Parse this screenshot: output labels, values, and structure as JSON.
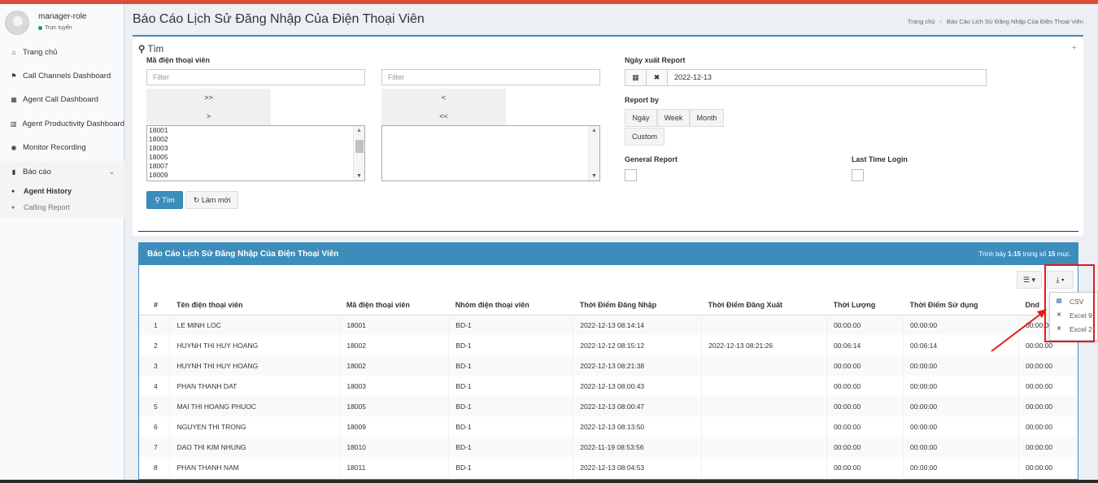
{
  "sidebar": {
    "user_name": "manager-role",
    "user_status": "Trực tuyến",
    "items": [
      {
        "label": "Trang chủ",
        "icon": "home-icon"
      },
      {
        "label": "Call Channels Dashboard",
        "icon": "flag-icon"
      },
      {
        "label": "Agent Call Dashboard",
        "icon": "grid-icon"
      },
      {
        "label": "Agent Productivity Dashboard",
        "icon": "bar-chart-icon"
      },
      {
        "label": "Monitor Recording",
        "icon": "record-icon"
      }
    ],
    "group": {
      "label": "Báo cáo",
      "icon": "book-icon",
      "subitems": [
        {
          "label": "Agent History",
          "active": true
        },
        {
          "label": "Calling Report",
          "active": false
        }
      ]
    }
  },
  "header": {
    "title": "Báo Cáo Lịch Sử Đăng Nhập Của Điện Thoại Viên",
    "breadcrumb_home": "Trang chủ",
    "breadcrumb_current": "Báo Cáo Lịch Sử Đăng Nhập Của Điện Thoại Viên"
  },
  "search": {
    "title": "Tìm",
    "agent_code_label": "Mã điện thoại viên",
    "filter_placeholder": "Filter",
    "move_all_right": ">>",
    "move_right": ">",
    "move_left": "<",
    "move_all_left": "<<",
    "available_agents": [
      "18001",
      "18002",
      "18003",
      "18005",
      "18007",
      "18009"
    ],
    "export_date_label": "Ngày xuất Report",
    "export_date_value": "2022-12-13",
    "report_by_label": "Report by",
    "report_by_options": [
      "Ngày",
      "Week",
      "Month",
      "Custom"
    ],
    "general_report_label": "General Report",
    "last_time_login_label": "Last Time Login",
    "search_button": "Tìm",
    "reset_button": "Làm mới"
  },
  "results": {
    "title": "Báo Cáo Lịch Sử Đăng Nhập Của Điện Thoại Viên",
    "summary_prefix": "Trình bày",
    "summary_range": "1-15",
    "summary_mid": "trong số",
    "summary_total": "15",
    "summary_suffix": "mục.",
    "columns": [
      "#",
      "Tên điện thoại viên",
      "Mã điện thoại viên",
      "Nhóm điện thoại viên",
      "Thời Điểm Đăng Nhập",
      "Thời Điểm Đăng Xuất",
      "Thời Lượng",
      "Thời Điểm Sử dụng",
      "Dnd"
    ],
    "rows": [
      [
        "1",
        "LE MINH LOC",
        "18001",
        "BD-1",
        "2022-12-13 08:14:14",
        "",
        "00:00:00",
        "00:00:00",
        "00:00:00"
      ],
      [
        "2",
        "HUYNH THI HUY HOANG",
        "18002",
        "BD-1",
        "2022-12-12 08:15:12",
        "2022-12-13 08:21:26",
        "00:06:14",
        "00:06:14",
        "00:00:00"
      ],
      [
        "3",
        "HUYNH THI HUY HOANG",
        "18002",
        "BD-1",
        "2022-12-13 08:21:38",
        "",
        "00:00:00",
        "00:00:00",
        "00:00:00"
      ],
      [
        "4",
        "PHAN THANH DAT",
        "18003",
        "BD-1",
        "2022-12-13 08:00:43",
        "",
        "00:00:00",
        "00:00:00",
        "00:00:00"
      ],
      [
        "5",
        "MAI THI HOANG PHUOC",
        "18005",
        "BD-1",
        "2022-12-13 08:00:47",
        "",
        "00:00:00",
        "00:00:00",
        "00:00:00"
      ],
      [
        "6",
        "NGUYEN THI TRONG",
        "18009",
        "BD-1",
        "2022-12-13 08:13:50",
        "",
        "00:00:00",
        "00:00:00",
        "00:00:00"
      ],
      [
        "7",
        "DAO THI KIM NHUNG",
        "18010",
        "BD-1",
        "2022-11-19 08:53:56",
        "",
        "00:00:00",
        "00:00:00",
        "00:00:00"
      ],
      [
        "8",
        "PHAN THANH NAM",
        "18011",
        "BD-1",
        "2022-12-13 08:04:53",
        "",
        "00:00:00",
        "00:00:00",
        "00:00:00"
      ]
    ]
  },
  "export_menu": {
    "items": [
      "CSV",
      "Excel 9",
      "Excel 2"
    ]
  },
  "colors": {
    "primary": "#3c8dbc",
    "topbar": "#dd4b39",
    "highlight": "#e31a1a",
    "online": "#00a65a"
  }
}
